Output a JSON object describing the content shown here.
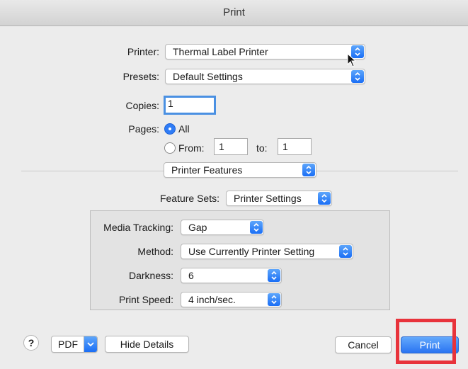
{
  "window": {
    "title": "Print"
  },
  "form": {
    "printer_label": "Printer:",
    "printer_value": "Thermal Label Printer",
    "presets_label": "Presets:",
    "presets_value": "Default Settings",
    "copies_label": "Copies:",
    "copies_value": "1",
    "pages_label": "Pages:",
    "pages_all": "All",
    "pages_from": "From:",
    "pages_from_value": "1",
    "pages_to": "to:",
    "pages_to_value": "1",
    "pages_selected": "All",
    "section_value": "Printer Features"
  },
  "features": {
    "feature_sets_label": "Feature Sets:",
    "feature_sets_value": "Printer Settings",
    "media_tracking_label": "Media Tracking:",
    "media_tracking_value": "Gap",
    "method_label": "Method:",
    "method_value": "Use Currently Printer Setting",
    "darkness_label": "Darkness:",
    "darkness_value": "6",
    "print_speed_label": "Print Speed:",
    "print_speed_value": "4 inch/sec."
  },
  "footer": {
    "help": "?",
    "pdf": "PDF",
    "hide_details": "Hide Details",
    "cancel": "Cancel",
    "print": "Print"
  },
  "colors": {
    "accent": "#2a74f2",
    "highlight": "#e8333b"
  }
}
